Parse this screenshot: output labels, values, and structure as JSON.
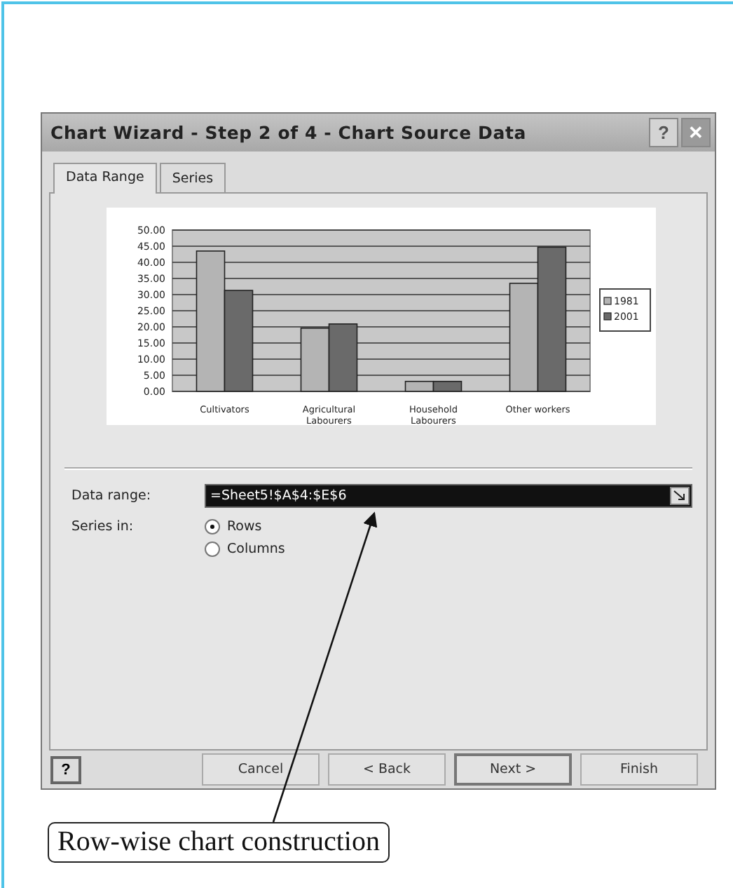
{
  "window": {
    "title": "Chart Wizard - Step 2 of 4 - Chart Source Data",
    "title_buttons": [
      "?",
      "✕"
    ]
  },
  "tabs": [
    {
      "label": "Data Range",
      "selected": true
    },
    {
      "label": "Series",
      "selected": false
    }
  ],
  "chart_data": {
    "type": "bar",
    "categories": [
      "Cultivators",
      "Agricultural Labourers",
      "Household Labourers",
      "Other workers"
    ],
    "series": [
      {
        "name": "1981",
        "color": "#b4b4b4",
        "values": [
          43.5,
          19.6,
          3.1,
          33.5
        ]
      },
      {
        "name": "2001",
        "color": "#6a6a6a",
        "values": [
          31.3,
          20.9,
          3.1,
          44.7
        ]
      }
    ],
    "ylim": [
      0,
      50
    ],
    "grid": true,
    "legend": "right",
    "yticks": [
      {
        "value": 0,
        "label": "0.00"
      },
      {
        "value": 5,
        "label": "5.00"
      },
      {
        "value": 10,
        "label": "10.00"
      },
      {
        "value": 15,
        "label": "15.00"
      },
      {
        "value": 20,
        "label": "20.00"
      },
      {
        "value": 25,
        "label": "25.00"
      },
      {
        "value": 30,
        "label": "30.00"
      },
      {
        "value": 35,
        "label": "35.00"
      },
      {
        "value": 40,
        "label": "40.00"
      },
      {
        "value": 45,
        "label": "45.00"
      },
      {
        "value": 50,
        "label": "50.00"
      }
    ]
  },
  "data_range": {
    "label": "Data range:",
    "value": "=Sheet5!$A$4:$E$6"
  },
  "series_in": {
    "label": "Series in:",
    "options": [
      {
        "label": "Rows",
        "selected": true
      },
      {
        "label": "Columns",
        "selected": false
      }
    ]
  },
  "help_button": "?",
  "buttons": [
    {
      "label": "Cancel",
      "default": false
    },
    {
      "label": "< Back",
      "default": false
    },
    {
      "label": "Next >",
      "default": true
    },
    {
      "label": "Finish",
      "default": false
    }
  ],
  "caption": "Row-wise chart construction"
}
